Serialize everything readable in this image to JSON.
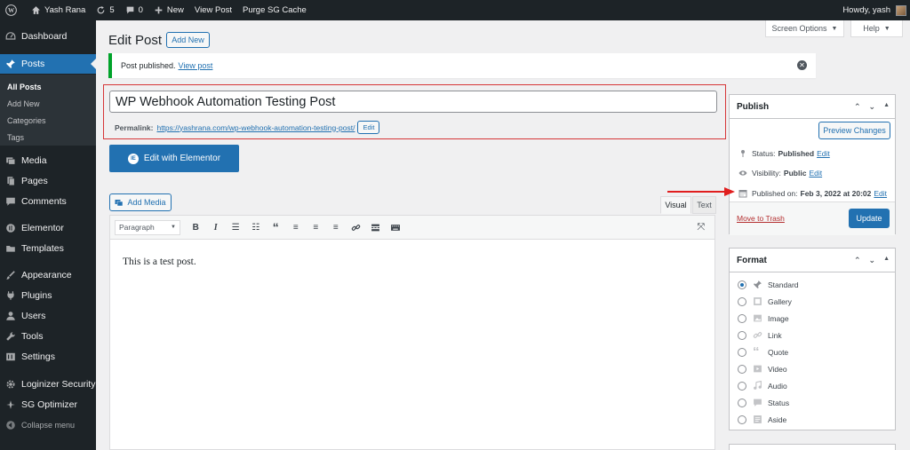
{
  "adminbar": {
    "site_name": "Yash Rana",
    "updates_count": "5",
    "comments_count": "0",
    "new_label": "New",
    "view_post": "View Post",
    "purge_cache": "Purge SG Cache",
    "howdy": "Howdy, yash"
  },
  "sidebar": {
    "dashboard": "Dashboard",
    "posts": "Posts",
    "sub": [
      "All Posts",
      "Add New",
      "Categories",
      "Tags"
    ],
    "media": "Media",
    "pages": "Pages",
    "comments": "Comments",
    "elementor": "Elementor",
    "templates": "Templates",
    "appearance": "Appearance",
    "plugins": "Plugins",
    "users": "Users",
    "tools": "Tools",
    "settings": "Settings",
    "loginizer": "Loginizer Security",
    "sg_optimizer": "SG Optimizer",
    "collapse": "Collapse menu"
  },
  "header": {
    "screen_options": "Screen Options",
    "help": "Help",
    "page_title": "Edit Post",
    "add_new": "Add New"
  },
  "notice": {
    "text": "Post published.",
    "link": "View post"
  },
  "post": {
    "title": "WP Webhook Automation Testing Post",
    "permalink_label": "Permalink:",
    "permalink_url": "https://yashrana.com/wp-webhook-automation-testing-post/",
    "edit": "Edit"
  },
  "editor": {
    "elementor_button": "Edit with Elementor",
    "add_media": "Add Media",
    "tab_visual": "Visual",
    "tab_text": "Text",
    "format_select": "Paragraph",
    "content": "This is a test post."
  },
  "publish": {
    "title": "Publish",
    "preview": "Preview Changes",
    "status_label": "Status:",
    "status_value": "Published",
    "visibility_label": "Visibility:",
    "visibility_value": "Public",
    "published_label": "Published on:",
    "published_value": "Feb 3, 2022 at 20:02",
    "edit": "Edit",
    "trash": "Move to Trash",
    "update": "Update"
  },
  "format": {
    "title": "Format",
    "selected": "Standard",
    "options": [
      "Standard",
      "Gallery",
      "Image",
      "Link",
      "Quote",
      "Video",
      "Audio",
      "Status",
      "Aside"
    ]
  },
  "colors": {
    "admin_dark": "#1d2327",
    "accent_blue": "#2271b1",
    "success_green": "#00a32a",
    "highlight_red": "#d63638"
  }
}
